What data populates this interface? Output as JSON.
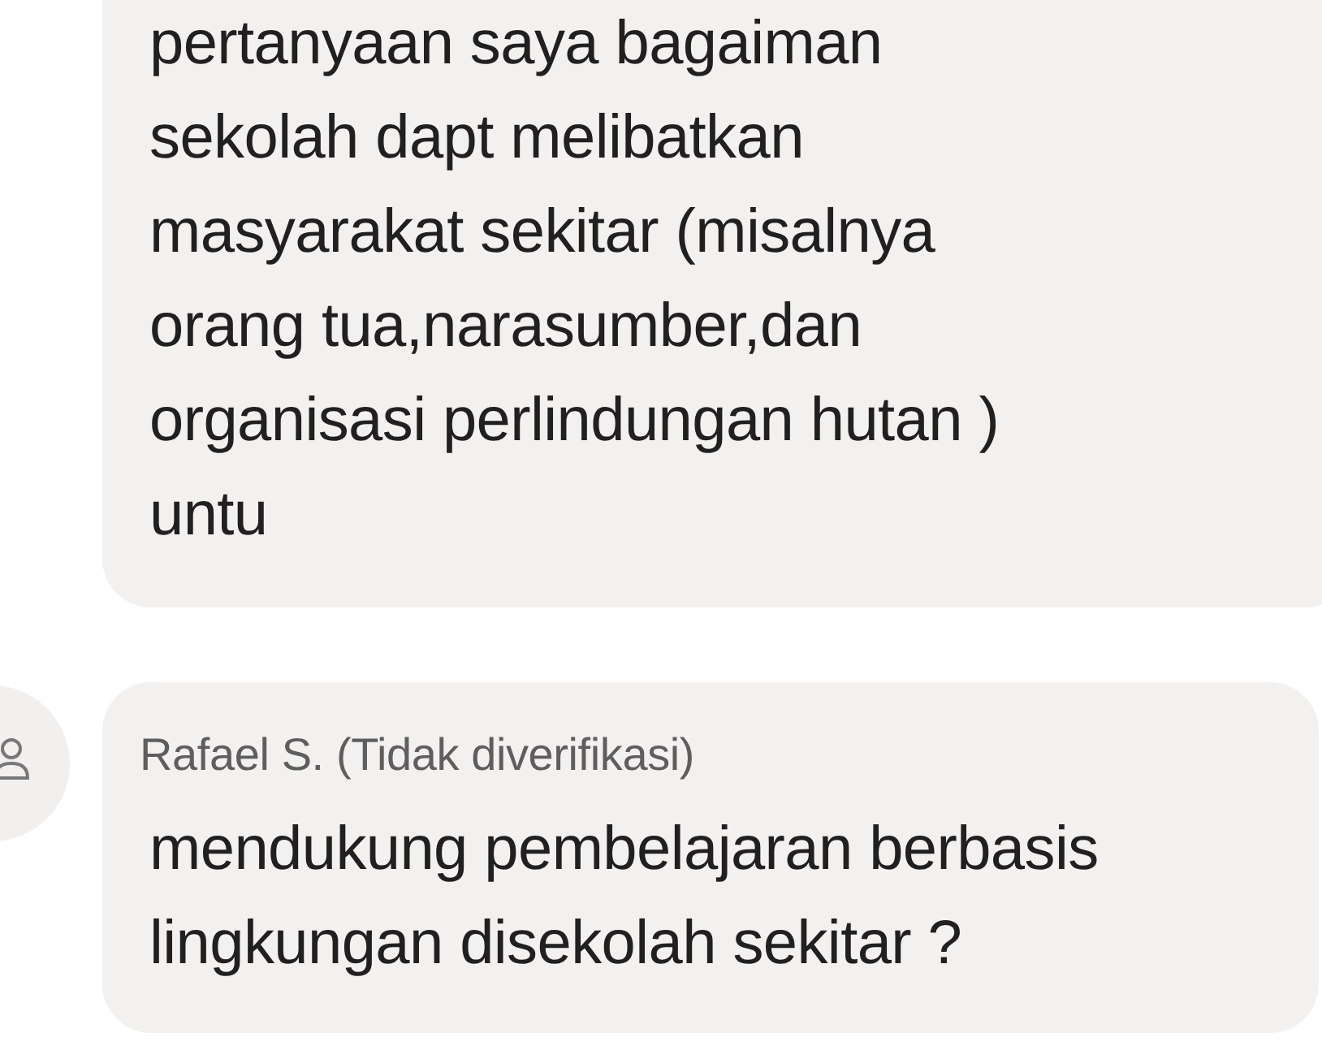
{
  "messages": [
    {
      "text": "pertanyaan saya bagaiman\nsekolah dapt melibatkan\nmasyarakat sekitar (misalnya\norang tua,narasumber,dan\norganisasi perlindungan hutan )\nuntu"
    },
    {
      "author": "Rafael S. (Tidak diverifikasi)",
      "text": "mendukung pembelajaran berbasis\nlingkungan disekolah sekitar ?"
    }
  ]
}
